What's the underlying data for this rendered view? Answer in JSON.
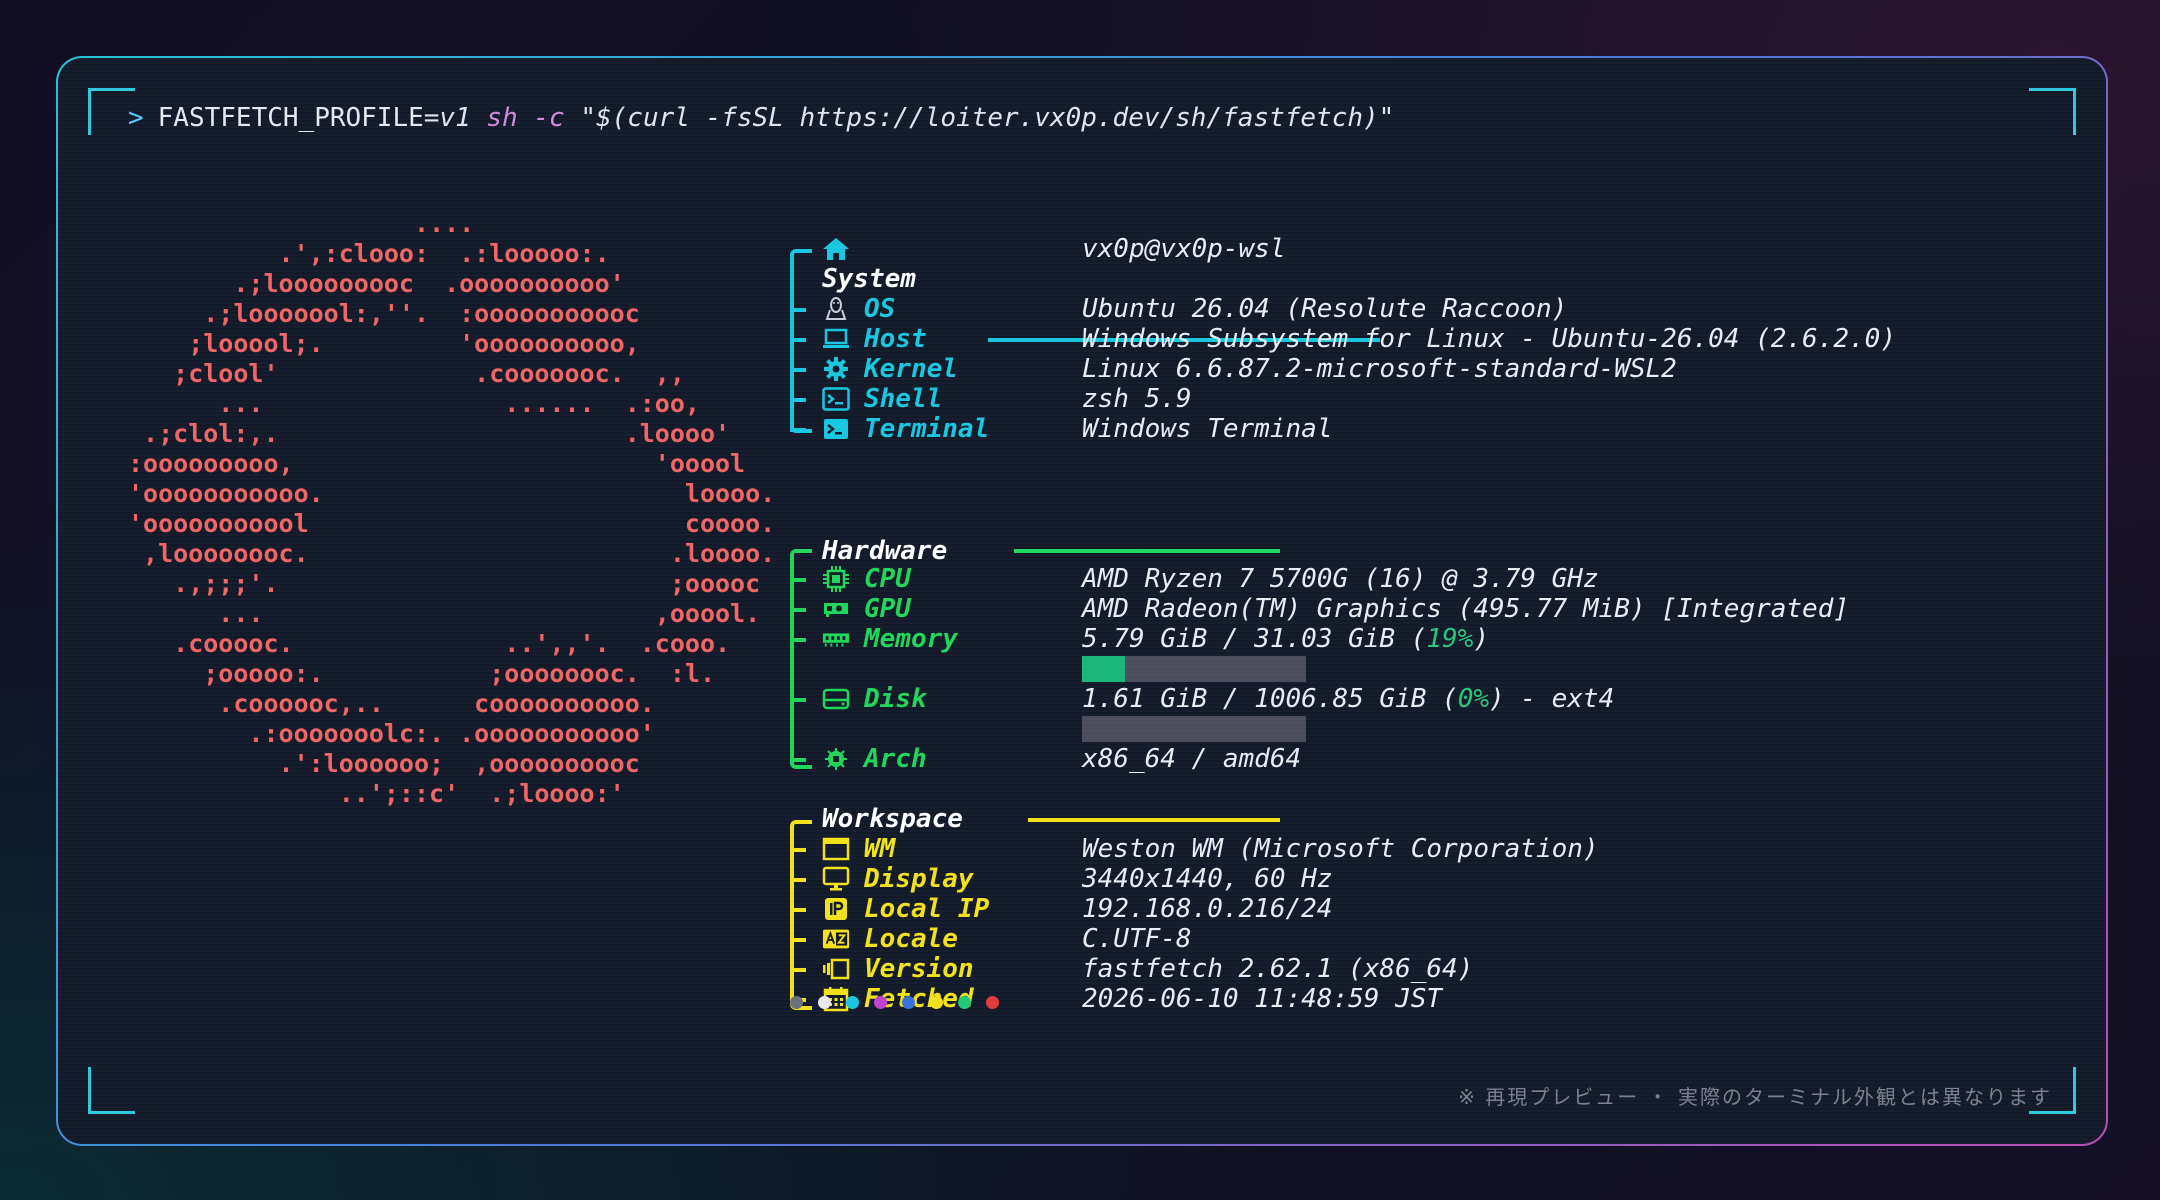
{
  "command": {
    "prompt": ">",
    "var": "FASTFETCH_PROFILE",
    "eq_value": "=v1",
    "sh": "sh -c",
    "rest": "\"$(curl -fsSL https://loiter.vx0p.dev/sh/fastfetch)\""
  },
  "logo_lines": [
    "                   ....",
    "          .',:clooo:  .:looooo:.",
    "       .;looooooooc  .oooooooooo'",
    "     .;looooool:,''.  :ooooooooooc",
    "    ;looool;.         'oooooooooo,",
    "   ;clool'             .cooooooc.  ,,",
    "      ...                ......  .:oo,",
    " .;clol:,.                       .loooo'",
    ":ooooooooo,                        'ooool",
    "'ooooooooooo.                        loooo.",
    "'ooooooooool                         coooo.",
    " ,loooooooc.                        .loooo.",
    "   .,;;;'.                          ;ooooc",
    "      ...                          ,ooool.",
    "   .cooooc.              ..',,'.  .cooo.",
    "     ;ooooo:.           ;oooooooc.  :l.",
    "      .coooooc,..      coooooooooo.",
    "        .:ooooooolc:. .ooooooooooo'",
    "          .':loooooo;  ,oooooooooc",
    "              ..';::c'  .;loooo:'"
  ],
  "user": {
    "icon": "home-icon",
    "value": "vx0p@vx0p-wsl"
  },
  "sections": {
    "system": {
      "title": "System",
      "color": "#17c7e0",
      "rows": [
        {
          "icon": "linux-icon",
          "key": "OS",
          "value": "Ubuntu 26.04 (Resolute Raccoon)"
        },
        {
          "icon": "laptop-icon",
          "key": "Host",
          "value": "Windows Subsystem for Linux - Ubuntu-26.04 (2.6.2.0)"
        },
        {
          "icon": "gear-icon",
          "key": "Kernel",
          "value": "Linux 6.6.87.2-microsoft-standard-WSL2"
        },
        {
          "icon": "shell-icon",
          "key": "Shell",
          "value": "zsh 5.9"
        },
        {
          "icon": "terminal-icon",
          "key": "Terminal",
          "value": "Windows Terminal"
        }
      ]
    },
    "hardware": {
      "title": "Hardware",
      "color": "#1fd65a",
      "rows": [
        {
          "icon": "cpu-icon",
          "key": "CPU",
          "value": "AMD Ryzen 7 5700G (16) @ 3.79 GHz"
        },
        {
          "icon": "gpu-icon",
          "key": "GPU",
          "value": "AMD Radeon(TM) Graphics (495.77 MiB) [Integrated]"
        },
        {
          "icon": "memory-icon",
          "key": "Memory",
          "value_pre": "5.79 GiB / 31.03 GiB (",
          "pct": "19%",
          "value_post": ")",
          "usage": 0.19
        },
        {
          "icon": "disk-icon",
          "key": "Disk",
          "value_pre": "1.61 GiB / 1006.85 GiB (",
          "pct": "0%",
          "value_post": ") - ext4",
          "usage": 0.0
        },
        {
          "icon": "chip-icon",
          "key": "Arch",
          "value": "x86_64 / amd64"
        }
      ]
    },
    "workspace": {
      "title": "Workspace",
      "color": "#f2e21a",
      "rows": [
        {
          "icon": "window-icon",
          "key": "WM",
          "value": "Weston WM (Microsoft Corporation)"
        },
        {
          "icon": "monitor-icon",
          "key": "Display",
          "value": "3440x1440, 60 Hz"
        },
        {
          "icon": "ip-icon",
          "key": "Local IP",
          "value": "192.168.0.216/24"
        },
        {
          "icon": "language-icon",
          "key": "Locale",
          "value": "C.UTF-8"
        },
        {
          "icon": "version-icon",
          "key": "Version",
          "value": "fastfetch 2.62.1 (x86_64)"
        },
        {
          "icon": "calendar-icon",
          "key": "Fetched",
          "value": "2026-06-10 11:48:59 JST"
        }
      ]
    }
  },
  "palette": [
    "#6b6f7a",
    "#e8e8ee",
    "#17c7e0",
    "#c040d0",
    "#3a6fe0",
    "#f2e21a",
    "#1fc777",
    "#e03a3a"
  ],
  "footnote": "※ 再現プレビュー ・ 実際のターミナル外観とは異なります"
}
